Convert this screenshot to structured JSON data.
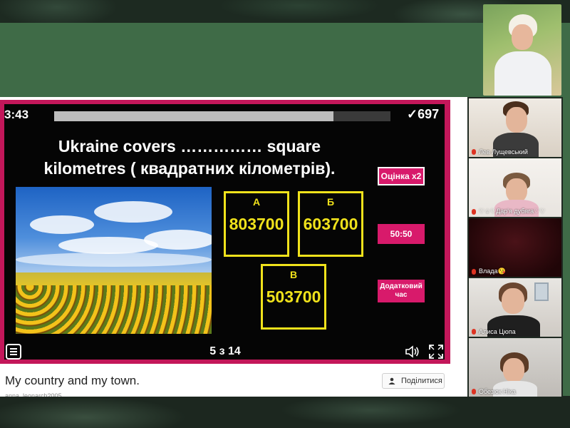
{
  "quiz": {
    "timer": "3:43",
    "progress_fraction": 0.83,
    "score": "✓697",
    "question_line1": "Ukraine covers …………… square",
    "question_line2": "kilometres ( квадратних кілометрів).",
    "answers": [
      {
        "letter": "А",
        "value": "803700"
      },
      {
        "letter": "Б",
        "value": "603700"
      },
      {
        "letter": "В",
        "value": "503700"
      }
    ],
    "powerups": {
      "double": "Оцінка x2",
      "fifty": "50:50",
      "extra_time": "Додатковий час"
    },
    "counter": "5 з 14",
    "accent_color": "#c3175a",
    "answer_color": "#f0e21b"
  },
  "page": {
    "title": "My country and my town.",
    "share_label": "Поділитися",
    "author": "anna_leonarch2005"
  },
  "participants": [
    {
      "name": "Лев Лущевський"
    },
    {
      "name": "♡♤♡Дар'я дубяга♡♡"
    },
    {
      "name": "Влада😘"
    },
    {
      "name": "Алиса Цюпа"
    },
    {
      "name": "Обезюк Ніка"
    }
  ]
}
